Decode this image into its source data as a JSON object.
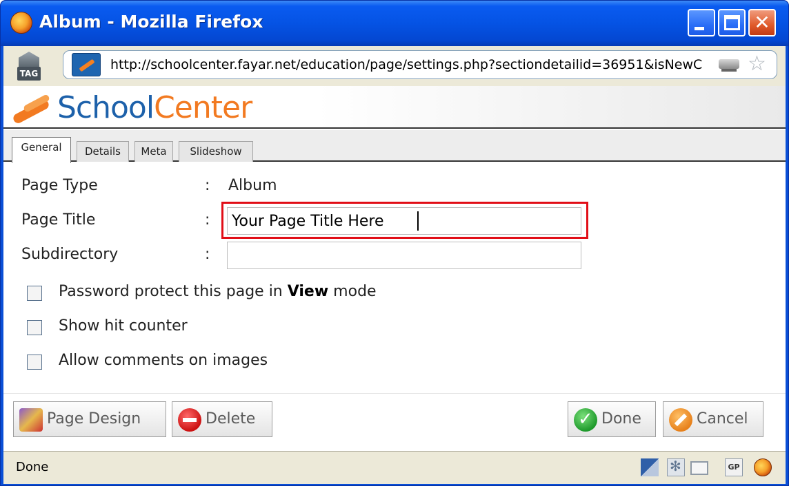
{
  "window": {
    "title": "Album - Mozilla Firefox"
  },
  "address_bar": {
    "tag_label": "TAG",
    "url": "http://schoolcenter.fayar.net/education/page/settings.php?sectiondetailid=36951&isNewC"
  },
  "brand": {
    "part1": "School",
    "part2": "Center",
    "colors": {
      "blue": "#1d61aa",
      "orange": "#f27a21"
    }
  },
  "tabs": [
    {
      "label": "General",
      "active": true
    },
    {
      "label": "Details",
      "active": false
    },
    {
      "label": "Meta",
      "active": false
    },
    {
      "label": "Slideshow",
      "active": false
    }
  ],
  "form": {
    "page_type_label": "Page Type",
    "page_type_value": "Album",
    "page_title_label": "Page Title",
    "page_title_value": "Your Page Title Here",
    "subdirectory_label": "Subdirectory",
    "subdirectory_value": "",
    "colon": ":",
    "checkboxes": [
      {
        "pre": "Password protect this page in ",
        "bold": "View",
        "post": " mode",
        "checked": false
      },
      {
        "pre": "Show hit counter",
        "bold": "",
        "post": "",
        "checked": false
      },
      {
        "pre": "Allow comments on images",
        "bold": "",
        "post": "",
        "checked": false
      }
    ]
  },
  "buttons": {
    "page_design": "Page Design",
    "delete": "Delete",
    "done": "Done",
    "cancel": "Cancel"
  },
  "status_bar": {
    "text": "Done",
    "gp_label": "GP"
  },
  "highlight_color": "#e10e17"
}
